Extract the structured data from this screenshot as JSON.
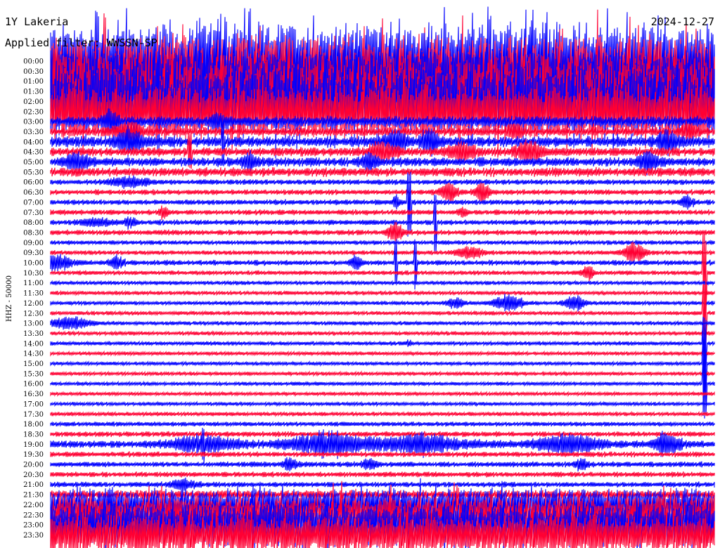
{
  "header": {
    "station": "1Y Lakeria",
    "date": "2024-12-27",
    "filter": "Applied filter: WWSSN-SP"
  },
  "chart_data": {
    "type": "line",
    "ylabel": "HHZ - 50000",
    "row_labels": [
      "00:00",
      "00:30",
      "01:00",
      "01:30",
      "02:00",
      "02:30",
      "03:00",
      "03:30",
      "04:00",
      "04:30",
      "05:00",
      "05:30",
      "06:00",
      "06:30",
      "07:00",
      "07:30",
      "08:00",
      "08:30",
      "09:00",
      "09:30",
      "10:00",
      "10:30",
      "11:00",
      "11:30",
      "12:00",
      "12:30",
      "13:00",
      "13:30",
      "14:00",
      "14:30",
      "15:00",
      "15:30",
      "16:00",
      "16:30",
      "17:00",
      "17:30",
      "18:00",
      "18:30",
      "19:00",
      "19:30",
      "20:00",
      "20:30",
      "21:00",
      "21:30",
      "22:00",
      "22:30",
      "23:00",
      "23:30"
    ],
    "series_colors": [
      "#0000ff",
      "#ff0033"
    ],
    "noise_level": [
      40,
      38,
      42,
      38,
      40,
      30,
      6,
      5,
      6,
      5,
      5,
      5,
      3,
      3,
      3,
      3,
      3,
      3,
      2.5,
      2.5,
      3,
      2.5,
      2.2,
      2.2,
      2.2,
      2.2,
      2.2,
      2.2,
      2.2,
      2,
      2,
      2,
      2,
      2,
      2,
      2.2,
      2.5,
      3,
      4,
      3,
      3,
      3,
      3,
      5,
      18,
      22,
      24,
      22
    ],
    "events": [
      {
        "row": 6,
        "pos": 0.09,
        "amp": 14,
        "width": 0.01
      },
      {
        "row": 6,
        "pos": 0.25,
        "amp": 10,
        "width": 0.008
      },
      {
        "row": 7,
        "pos": 0.12,
        "amp": 12,
        "width": 0.02
      },
      {
        "row": 7,
        "pos": 0.7,
        "amp": 10,
        "width": 0.012
      },
      {
        "row": 7,
        "pos": 0.96,
        "amp": 12,
        "width": 0.01
      },
      {
        "row": 8,
        "pos": 0.12,
        "amp": 16,
        "width": 0.02
      },
      {
        "row": 8,
        "pos": 0.52,
        "amp": 14,
        "width": 0.015
      },
      {
        "row": 8,
        "pos": 0.57,
        "amp": 16,
        "width": 0.012
      },
      {
        "row": 8,
        "pos": 0.93,
        "amp": 14,
        "width": 0.015
      },
      {
        "row": 9,
        "pos": 0.5,
        "amp": 12,
        "width": 0.02
      },
      {
        "row": 9,
        "pos": 0.62,
        "amp": 12,
        "width": 0.02
      },
      {
        "row": 9,
        "pos": 0.72,
        "amp": 14,
        "width": 0.02
      },
      {
        "row": 10,
        "pos": 0.04,
        "amp": 10,
        "width": 0.02
      },
      {
        "row": 10,
        "pos": 0.3,
        "amp": 12,
        "width": 0.01
      },
      {
        "row": 10,
        "pos": 0.48,
        "amp": 12,
        "width": 0.01
      },
      {
        "row": 10,
        "pos": 0.9,
        "amp": 12,
        "width": 0.015
      },
      {
        "row": 12,
        "pos": 0.12,
        "amp": 6,
        "width": 0.03
      },
      {
        "row": 13,
        "pos": 0.6,
        "amp": 12,
        "width": 0.012
      },
      {
        "row": 13,
        "pos": 0.65,
        "amp": 12,
        "width": 0.012
      },
      {
        "row": 14,
        "pos": 0.52,
        "amp": 10,
        "width": 0.004
      },
      {
        "row": 14,
        "pos": 0.96,
        "amp": 10,
        "width": 0.008
      },
      {
        "row": 15,
        "pos": 0.17,
        "amp": 8,
        "width": 0.006
      },
      {
        "row": 15,
        "pos": 0.62,
        "amp": 6,
        "width": 0.008
      },
      {
        "row": 16,
        "pos": 0.07,
        "amp": 6,
        "width": 0.02
      },
      {
        "row": 16,
        "pos": 0.12,
        "amp": 6,
        "width": 0.01
      },
      {
        "row": 17,
        "pos": 0.52,
        "amp": 12,
        "width": 0.012
      },
      {
        "row": 19,
        "pos": 0.63,
        "amp": 8,
        "width": 0.02
      },
      {
        "row": 19,
        "pos": 0.88,
        "amp": 14,
        "width": 0.015
      },
      {
        "row": 20,
        "pos": 0.01,
        "amp": 10,
        "width": 0.02
      },
      {
        "row": 20,
        "pos": 0.1,
        "amp": 8,
        "width": 0.01
      },
      {
        "row": 20,
        "pos": 0.46,
        "amp": 8,
        "width": 0.008
      },
      {
        "row": 21,
        "pos": 0.81,
        "amp": 10,
        "width": 0.008
      },
      {
        "row": 24,
        "pos": 0.61,
        "amp": 7,
        "width": 0.012
      },
      {
        "row": 24,
        "pos": 0.69,
        "amp": 12,
        "width": 0.02
      },
      {
        "row": 24,
        "pos": 0.79,
        "amp": 10,
        "width": 0.015
      },
      {
        "row": 26,
        "pos": 0.03,
        "amp": 8,
        "width": 0.03
      },
      {
        "row": 28,
        "pos": 0.54,
        "amp": 5,
        "width": 0.004
      },
      {
        "row": 38,
        "pos": 0.23,
        "amp": 10,
        "width": 0.05
      },
      {
        "row": 38,
        "pos": 0.42,
        "amp": 14,
        "width": 0.06
      },
      {
        "row": 38,
        "pos": 0.56,
        "amp": 12,
        "width": 0.06
      },
      {
        "row": 38,
        "pos": 0.78,
        "amp": 12,
        "width": 0.05
      },
      {
        "row": 38,
        "pos": 0.93,
        "amp": 12,
        "width": 0.02
      },
      {
        "row": 40,
        "pos": 0.36,
        "amp": 8,
        "width": 0.01
      },
      {
        "row": 40,
        "pos": 0.48,
        "amp": 8,
        "width": 0.01
      },
      {
        "row": 40,
        "pos": 0.8,
        "amp": 8,
        "width": 0.01
      },
      {
        "row": 42,
        "pos": 0.2,
        "amp": 6,
        "width": 0.02
      }
    ],
    "spikes": [
      {
        "row": 0,
        "pos": 0.07,
        "amp": 80
      },
      {
        "row": 0,
        "pos": 0.3,
        "amp": 90
      },
      {
        "row": 0,
        "pos": 0.66,
        "amp": 80
      },
      {
        "row": 8,
        "pos": 0.26,
        "amp": 40
      },
      {
        "row": 9,
        "pos": 0.21,
        "amp": 30
      },
      {
        "row": 14,
        "pos": 0.54,
        "amp": 50
      },
      {
        "row": 16,
        "pos": 0.58,
        "amp": 50
      },
      {
        "row": 20,
        "pos": 0.52,
        "amp": 40
      },
      {
        "row": 20,
        "pos": 0.55,
        "amp": 40
      },
      {
        "row": 21,
        "pos": 0.985,
        "amp": 60
      },
      {
        "row": 25,
        "pos": 0.985,
        "amp": 50
      },
      {
        "row": 28,
        "pos": 0.985,
        "amp": 40
      },
      {
        "row": 30,
        "pos": 0.985,
        "amp": 50
      },
      {
        "row": 32,
        "pos": 0.985,
        "amp": 50
      },
      {
        "row": 38,
        "pos": 0.23,
        "amp": 30
      },
      {
        "row": 38,
        "pos": 0.41,
        "amp": 25
      },
      {
        "row": 38,
        "pos": 0.56,
        "amp": 20
      },
      {
        "row": 38,
        "pos": 0.92,
        "amp": 20
      },
      {
        "row": 45,
        "pos": 0.22,
        "amp": 30
      },
      {
        "row": 45,
        "pos": 0.58,
        "amp": 25
      }
    ]
  }
}
